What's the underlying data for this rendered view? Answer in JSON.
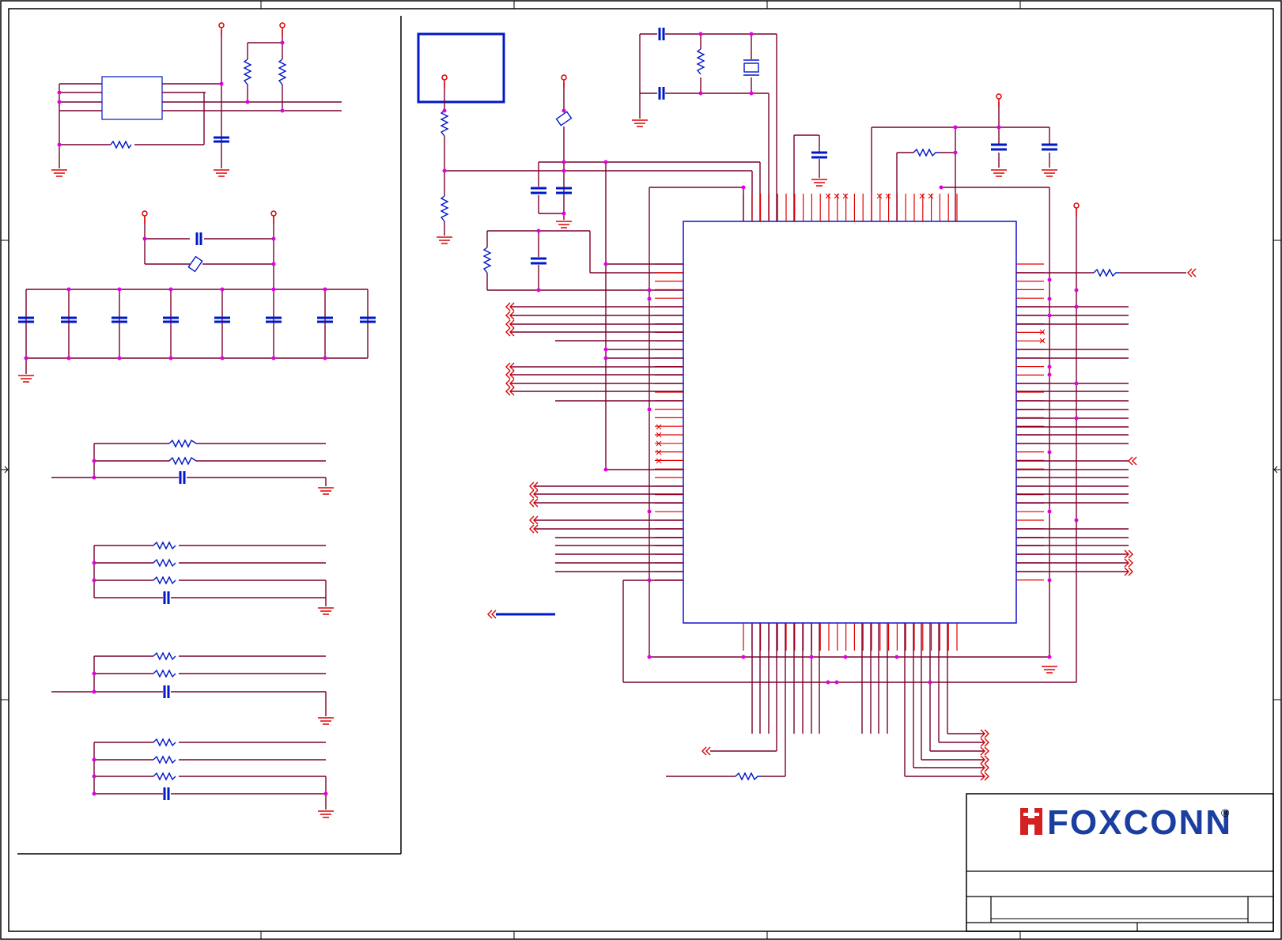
{
  "title_block": {
    "logo_text": "FOXCONN",
    "registered_mark": "®",
    "colors": {
      "logo": "#1a3fa0",
      "logo_mark": "#d42020",
      "border": "#000000"
    }
  },
  "colors": {
    "wire": "#7a0030",
    "pin": "#e00000",
    "junction": "#e000e0",
    "component": "#0018c8",
    "chip_outline": "#0000cc",
    "border": "#000000"
  },
  "icons": {
    "power": "power-rail-icon",
    "ground": "ground-icon",
    "resistor": "resistor-icon",
    "capacitor": "capacitor-icon",
    "crystal": "crystal-icon",
    "offpage": "offpage-connector-icon",
    "noconnect": "no-connect-icon"
  }
}
